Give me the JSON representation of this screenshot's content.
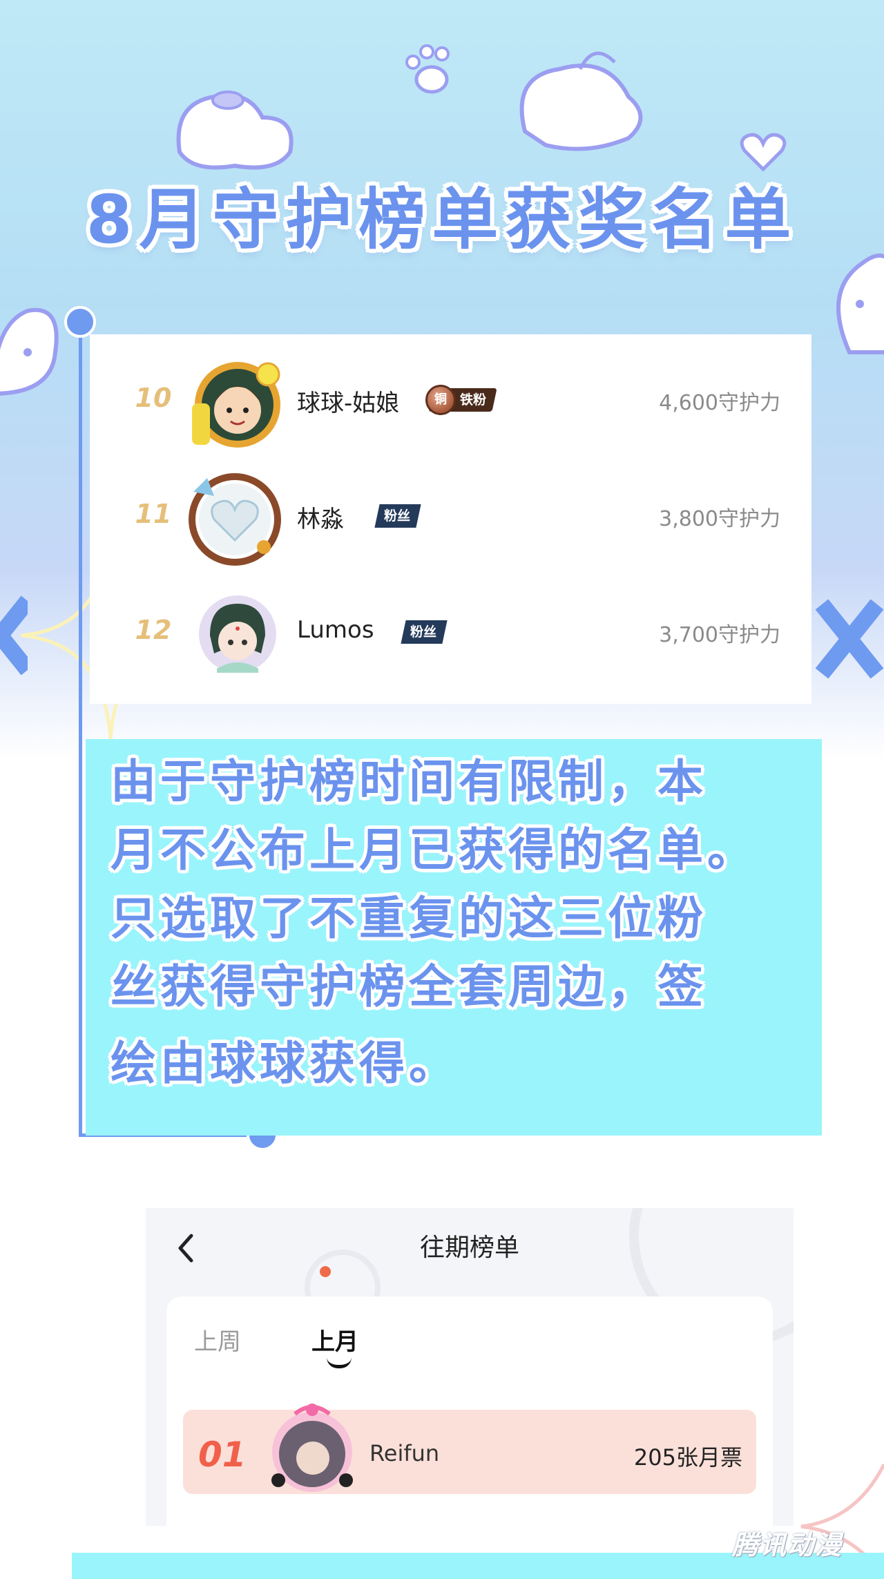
{
  "title": "8月守护榜单获奖名单",
  "ranking": [
    {
      "rank": "10",
      "name": "球球-姑娘",
      "badge": "铁粉",
      "medal": "铜",
      "score": "4,600守护力"
    },
    {
      "rank": "11",
      "name": "林淼",
      "badge": "粉丝",
      "score": "3,800守护力"
    },
    {
      "rank": "12",
      "name": "Lumos",
      "badge": "粉丝",
      "score": "3,700守护力"
    }
  ],
  "notice": {
    "lines": [
      "由于守护榜时间有限制，本",
      "月不公布上月已获得的名单。",
      "只选取了不重复的这三位粉",
      "丝获得守护榜全套周边，签",
      "绘由球球获得。"
    ]
  },
  "past_list": {
    "back": "‹",
    "title": "往期榜单",
    "tabs": [
      "上周",
      "上月"
    ],
    "active_tab": "上月",
    "first": {
      "rank": "01",
      "name": "Reifun",
      "score": "205张月票"
    }
  },
  "watermark": "腾讯动漫",
  "colors": {
    "title": "#6b93ee",
    "notice_bg": "#9af4fb",
    "rank_gold": "#e5bf7a",
    "first_row_bg": "#fbe0d9",
    "first_num": "#f0604a"
  }
}
